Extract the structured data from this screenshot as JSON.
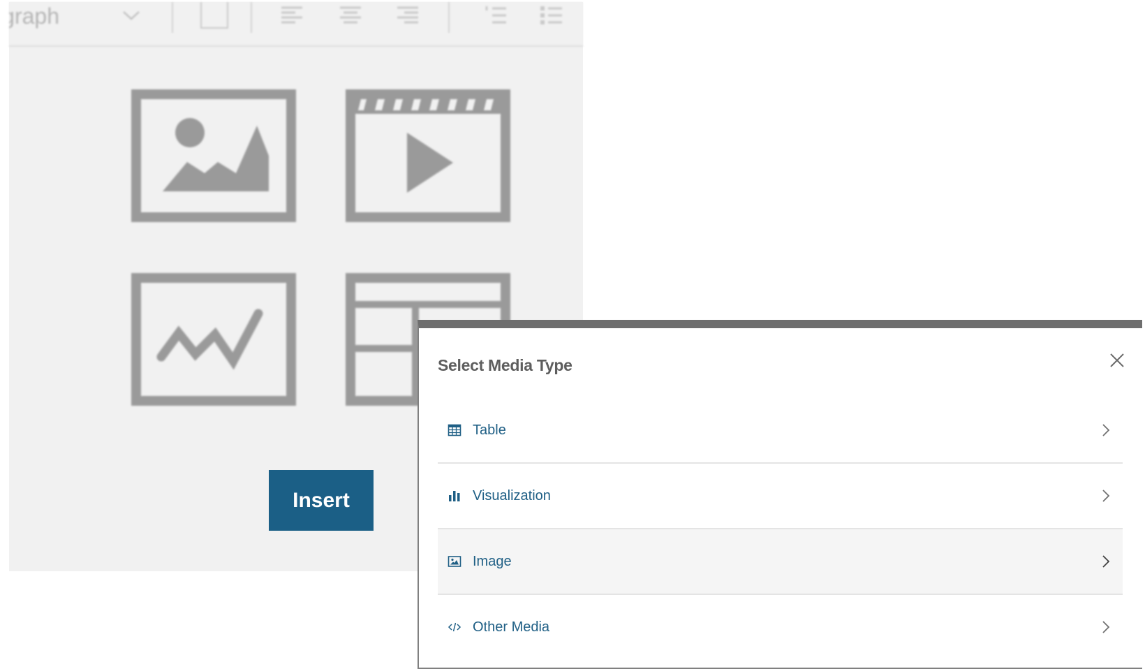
{
  "editor": {
    "format_dropdown_text": "Paragraph",
    "insert_button_label": "Insert"
  },
  "modal": {
    "title": "Select Media Type",
    "close_icon": "close-icon",
    "items": [
      {
        "label": "Table",
        "icon": "table-icon"
      },
      {
        "label": "Visualization",
        "icon": "bar-chart-icon"
      },
      {
        "label": "Image",
        "icon": "image-icon"
      },
      {
        "label": "Other Media",
        "icon": "code-icon"
      }
    ]
  },
  "colors": {
    "accent": "#1f5f85",
    "insert_button": "#1b5f86",
    "tile_gray": "#9a9a9a",
    "panel_bg": "#f1f1f1"
  }
}
